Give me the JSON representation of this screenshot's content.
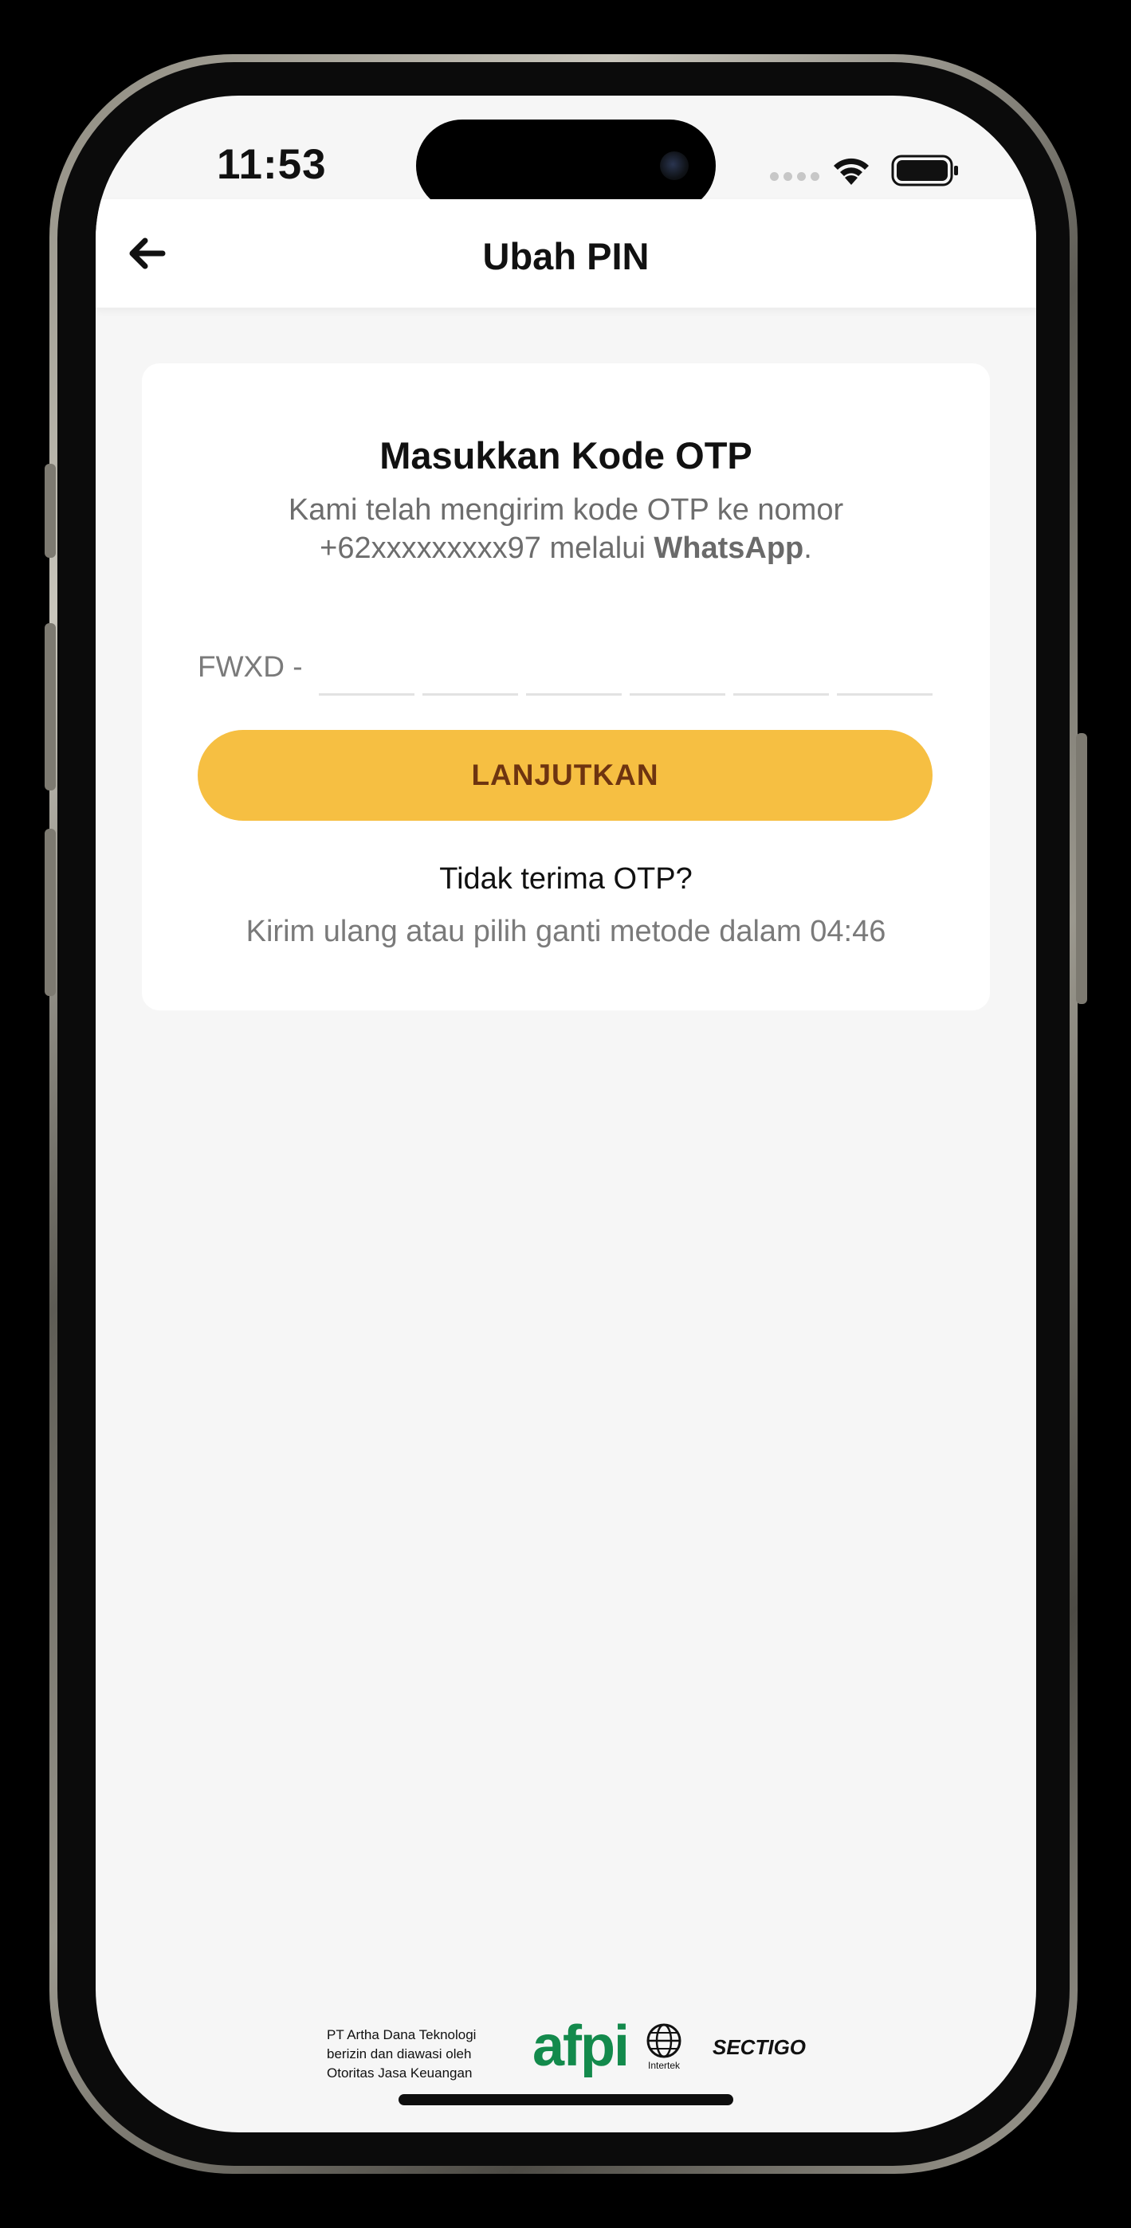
{
  "status_bar": {
    "time": "11:53"
  },
  "header": {
    "title": "Ubah PIN",
    "back_icon": "arrow-left-icon"
  },
  "otp_card": {
    "title": "Masukkan Kode OTP",
    "description_line1": "Kami telah mengirim kode OTP ke nomor",
    "description_line2_prefix": "+62xxxxxxxxx97 melalui ",
    "description_channel": "WhatsApp",
    "description_line2_suffix": ".",
    "otp_prefix": "FWXD -",
    "otp_digits": [
      "",
      "",
      "",
      "",
      "",
      ""
    ],
    "submit_label": "LANJUTKAN",
    "no_otp_text": "Tidak terima OTP?",
    "resend_text": "Kirim ulang atau pilih ganti metode dalam 04:46"
  },
  "footer": {
    "license_line1": "PT Artha Dana Teknologi",
    "license_line2": "berizin dan diawasi oleh",
    "license_line3": "Otoritas Jasa Keuangan",
    "afpi_logo_text": "afpi",
    "intertek_label": "Intertek",
    "sectigo_label": "SECTIGO"
  },
  "colors": {
    "accent": "#f6bf42",
    "accent_text": "#6e3410",
    "background": "#f6f6f6",
    "card": "#ffffff",
    "afpi_green": "#138a4c"
  }
}
